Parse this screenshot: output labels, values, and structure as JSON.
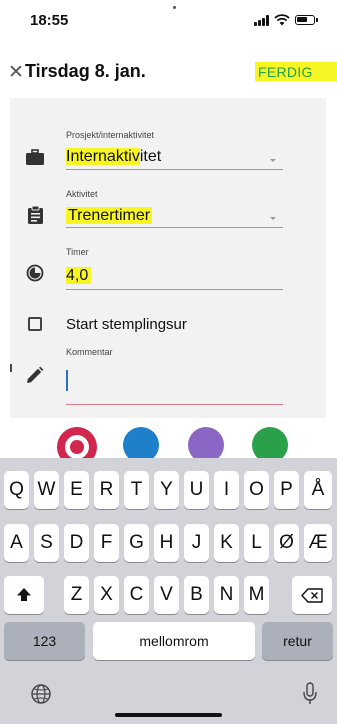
{
  "status_bar": {
    "time": "18:55"
  },
  "header": {
    "title": "Tirsdag 8. jan.",
    "done_label": "FERDIG"
  },
  "form": {
    "project": {
      "label": "Prosjekt/internaktivitet",
      "value_highlighted": "Internaktiv",
      "value_rest": "itet"
    },
    "activity": {
      "label": "Aktivitet",
      "value": "Trenertimer"
    },
    "hours": {
      "label": "Timer",
      "value": "4,0"
    },
    "stopwatch": {
      "label": "Start stemplingsur",
      "checked": false
    },
    "comment": {
      "label": "Kommentar",
      "value": ""
    }
  },
  "colors": {
    "options": [
      "#d1264e",
      "#1e7fcb",
      "#8a67c4",
      "#2ba04a"
    ],
    "selected": "#d1264e"
  },
  "keyboard": {
    "row1": [
      "Q",
      "W",
      "E",
      "R",
      "T",
      "Y",
      "U",
      "I",
      "O",
      "P",
      "Å"
    ],
    "row2": [
      "A",
      "S",
      "D",
      "F",
      "G",
      "H",
      "J",
      "K",
      "L",
      "Ø",
      "Æ"
    ],
    "row3": [
      "Z",
      "X",
      "C",
      "V",
      "B",
      "N",
      "M"
    ],
    "numbers_label": "123",
    "space_label": "mellomrom",
    "return_label": "retur"
  }
}
